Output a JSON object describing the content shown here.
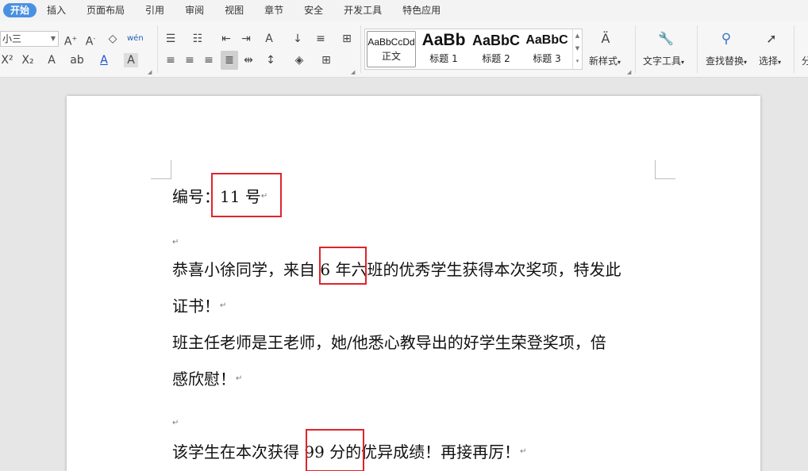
{
  "tabs": [
    "开始",
    "插入",
    "页面布局",
    "引用",
    "审阅",
    "视图",
    "章节",
    "安全",
    "开发工具",
    "特色应用"
  ],
  "ribbon": {
    "font_size": "小三",
    "styles": [
      {
        "sample": "AaBbCcDd",
        "caption": "正文"
      },
      {
        "sample": "AaBb",
        "caption": "标题 1"
      },
      {
        "sample": "AaBbC",
        "caption": "标题 2"
      },
      {
        "sample": "AaBbC",
        "caption": "标题 3"
      }
    ],
    "new_style": "新样式",
    "text_tools": "文字工具",
    "find_replace": "查找替换",
    "select": "选择",
    "cut_label": "分"
  },
  "document": {
    "line1_prefix": "编号：",
    "line1_value": "11 号",
    "line3": "恭喜小徐同学，来自 6 年六班的优秀学生获得本次奖项，特发此",
    "line4": "证书！",
    "line5": "班主任老师是王老师，她/他悉心教导出的好学生荣登奖项，倍",
    "line6": "感欣慰！",
    "line8": "该学生在本次获得 99 分的优异成绩！再接再厉！"
  },
  "colors": {
    "accent": "#4a90e2",
    "highlight_box": "#e0242b"
  }
}
